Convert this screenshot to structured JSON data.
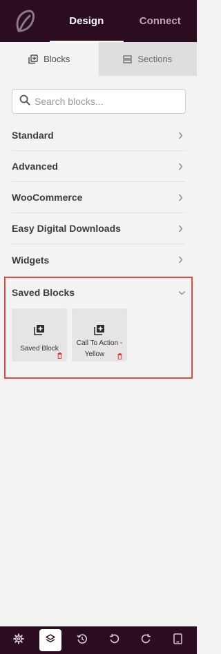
{
  "header": {
    "tabs": [
      {
        "label": "Design",
        "active": true
      },
      {
        "label": "Connect",
        "active": false
      }
    ]
  },
  "subtabs": [
    {
      "label": "Blocks",
      "icon": "blocks-icon",
      "active": true
    },
    {
      "label": "Sections",
      "icon": "sections-icon",
      "active": false
    }
  ],
  "search": {
    "placeholder": "Search blocks...",
    "value": ""
  },
  "categories": [
    {
      "label": "Standard"
    },
    {
      "label": "Advanced"
    },
    {
      "label": "WooCommerce"
    },
    {
      "label": "Easy Digital Downloads"
    },
    {
      "label": "Widgets"
    }
  ],
  "saved_blocks": {
    "title": "Saved Blocks",
    "expanded": true,
    "items": [
      {
        "label": "Saved Block"
      },
      {
        "label_line1": "Call To Action -",
        "label_line2": "Yellow"
      }
    ]
  },
  "bottom_toolbar": [
    {
      "icon": "gear-icon",
      "active": false
    },
    {
      "icon": "layers-icon",
      "active": true
    },
    {
      "icon": "history-icon",
      "active": false
    },
    {
      "icon": "undo-icon",
      "active": false
    },
    {
      "icon": "redo-icon",
      "active": false
    },
    {
      "icon": "tablet-icon",
      "active": false
    }
  ],
  "colors": {
    "header_bg": "#2b0d1f",
    "panel_bg": "#f3f3f3",
    "highlight_border": "#e34b3a",
    "trash": "#e0393e"
  }
}
